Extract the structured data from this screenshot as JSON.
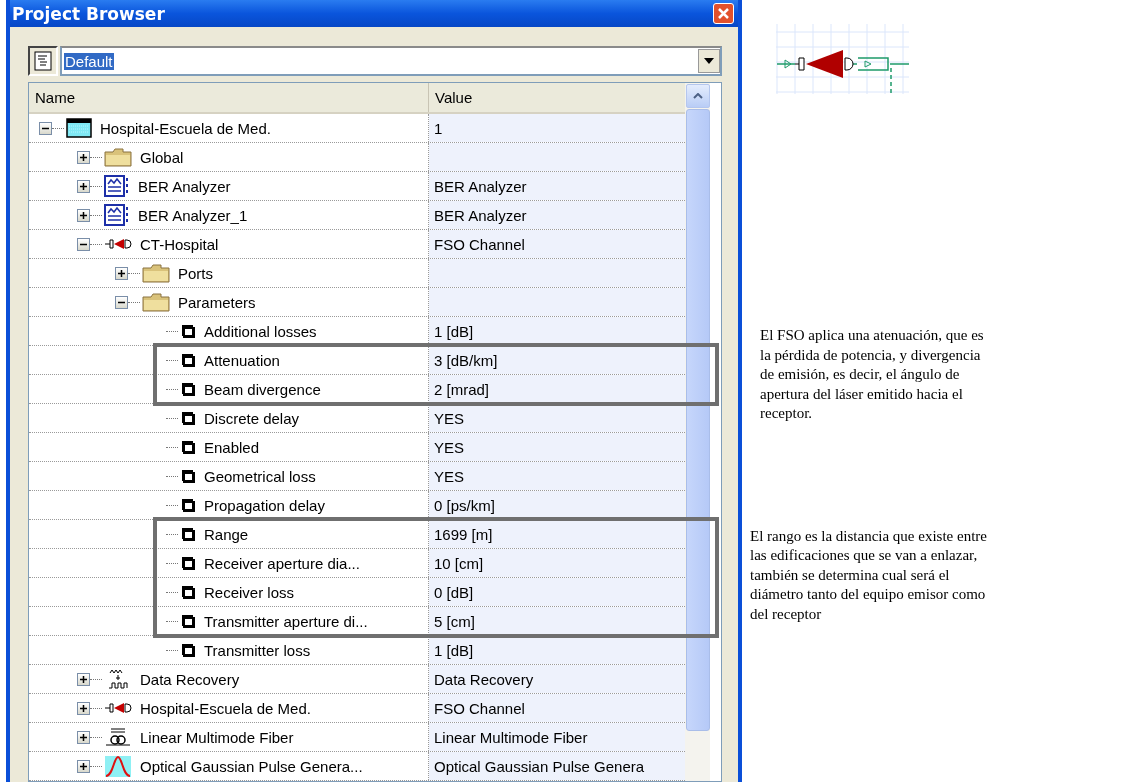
{
  "window": {
    "title": "Project Browser"
  },
  "selector": {
    "value": "Default",
    "selected": true
  },
  "table": {
    "columns": [
      "Name",
      "Value"
    ],
    "rows": [
      {
        "name": "Hospital-Escuela de Med.",
        "value": "1",
        "kind": "project",
        "expanded": true,
        "children": [
          {
            "name": "Global",
            "kind": "folder",
            "expanded": false
          },
          {
            "name": "BER Analyzer",
            "value": "BER Analyzer",
            "kind": "analyzer",
            "expanded": false
          },
          {
            "name": "BER Analyzer_1",
            "value": "BER Analyzer",
            "kind": "analyzer",
            "expanded": false
          },
          {
            "name": "CT-Hospital",
            "value": "FSO Channel",
            "kind": "fso",
            "expanded": true,
            "children": [
              {
                "name": "Ports",
                "kind": "folder",
                "expanded": false
              },
              {
                "name": "Parameters",
                "kind": "folder",
                "expanded": true,
                "children": [
                  {
                    "name": "Additional losses",
                    "value": "1 [dB]",
                    "kind": "param"
                  },
                  {
                    "name": "Attenuation",
                    "value": "3 [dB/km]",
                    "kind": "param",
                    "framed": true
                  },
                  {
                    "name": "Beam divergence",
                    "value": "2 [mrad]",
                    "kind": "param",
                    "framed": true
                  },
                  {
                    "name": "Discrete delay",
                    "value": "YES",
                    "kind": "param"
                  },
                  {
                    "name": "Enabled",
                    "value": "YES",
                    "kind": "param"
                  },
                  {
                    "name": "Geometrical loss",
                    "value": "YES",
                    "kind": "param"
                  },
                  {
                    "name": "Propagation delay",
                    "value": "0 [ps/km]",
                    "kind": "param"
                  },
                  {
                    "name": "Range",
                    "value": "1699 [m]",
                    "kind": "param",
                    "framed": true
                  },
                  {
                    "name": "Receiver aperture dia...",
                    "value": "10 [cm]",
                    "kind": "param",
                    "framed": true
                  },
                  {
                    "name": "Receiver loss",
                    "value": "0 [dB]",
                    "kind": "param",
                    "framed": true
                  },
                  {
                    "name": "Transmitter aperture di...",
                    "value": "5 [cm]",
                    "kind": "param",
                    "framed": true
                  },
                  {
                    "name": "Transmitter loss",
                    "value": "1 [dB]",
                    "kind": "param"
                  }
                ]
              }
            ]
          },
          {
            "name": "Data Recovery",
            "value": "Data Recovery",
            "kind": "recovery",
            "expanded": false
          },
          {
            "name": "Hospital-Escuela de Med.",
            "value": "FSO Channel",
            "kind": "fso",
            "expanded": false
          },
          {
            "name": "Linear Multimode Fiber",
            "value": "Linear Multimode Fiber",
            "kind": "fiber",
            "expanded": false
          },
          {
            "name": "Optical Gaussian Pulse Genera...",
            "value": "Optical Gaussian Pulse Genera",
            "kind": "gaussian",
            "expanded": false
          }
        ]
      }
    ]
  },
  "notes": [
    "El FSO aplica una atenuación, que es la pérdida de potencia, y divergencia de emisión, es decir, el ángulo de apertura del láser emitido hacia el receptor.",
    "El rango es la distancia que existe entre las edificaciones que se van a enlazar, también se determina cual será el diámetro tanto del equipo emisor como del receptor"
  ]
}
